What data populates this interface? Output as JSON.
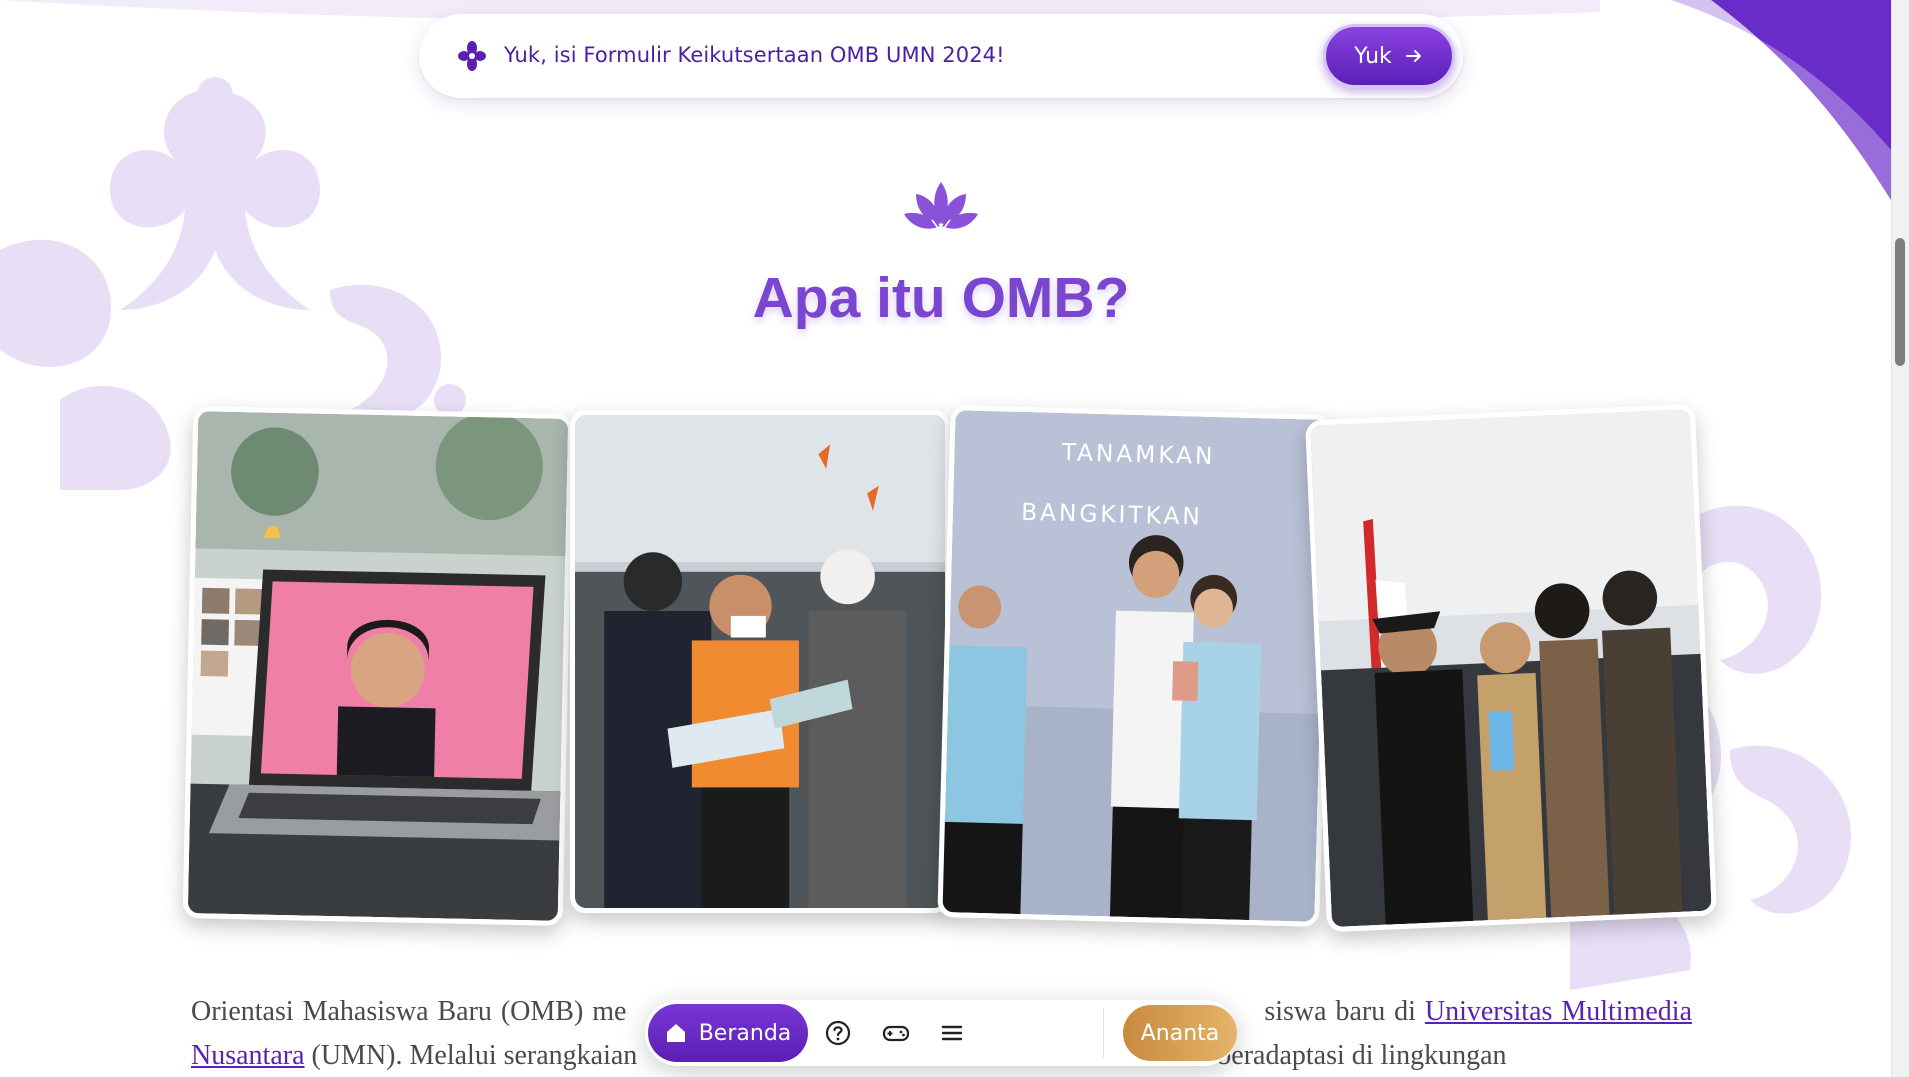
{
  "banner": {
    "message": "Yuk, isi Formulir Keikutsertaan OMB UMN 2024!",
    "button_label": "Yuk"
  },
  "section": {
    "title": "Apa itu OMB?"
  },
  "intro": {
    "text_start": "Orientasi Mahasiswa Baru (OMB) me",
    "text_mid1": "siswa baru di",
    "link_label": "Universitas Multimedia Nusantara",
    "text_after_link": "(UMN). Melalui serangkaian",
    "text_end": "siswa baru beradaptasi di lingkungan"
  },
  "bottom_nav": {
    "home_label": "Beranda",
    "user_label": "Ananta",
    "icons": [
      "help-icon",
      "gamepad-icon",
      "menu-icon"
    ]
  },
  "photos": {
    "photo_3_banner_line1": "TANAMKAN",
    "photo_3_banner_line2": "BANGKITKAN"
  },
  "colors": {
    "primary": "#6a2cc8",
    "ornament": "#ece4f8",
    "accent_gold": "#d49a4e"
  }
}
